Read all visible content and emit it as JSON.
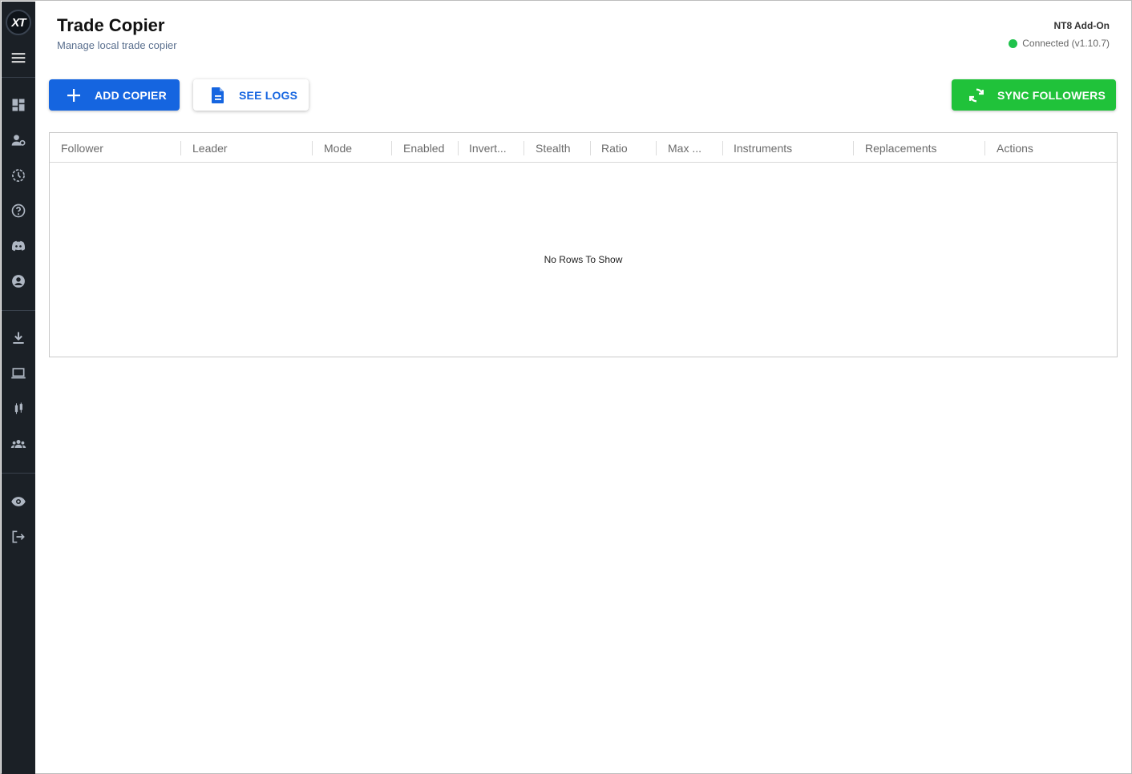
{
  "app": {
    "logo_text": "XT",
    "title": "Trade Copier",
    "subtitle": "Manage local trade copier",
    "addon_label": "NT8 Add-On",
    "status_text": "Connected (v1.10.7)",
    "status_color": "#1fc24b"
  },
  "sidebar": {
    "icons": [
      "menu-icon",
      "dashboard-icon",
      "account-settings-icon",
      "history-icon",
      "help-icon",
      "discord-icon",
      "user-icon",
      "download-icon",
      "laptop-icon",
      "candlestick-icon",
      "group-icon",
      "eye-icon",
      "logout-icon"
    ]
  },
  "toolbar": {
    "add_label": "ADD COPIER",
    "logs_label": "SEE LOGS",
    "sync_label": "SYNC FOLLOWERS",
    "add_color": "#1565e0",
    "sync_color": "#20c23a"
  },
  "grid": {
    "columns": [
      "Follower",
      "Leader",
      "Mode",
      "Enabled",
      "Invert...",
      "Stealth",
      "Ratio",
      "Max ...",
      "Instruments",
      "Replacements",
      "Actions"
    ],
    "empty_text": "No Rows To Show"
  }
}
